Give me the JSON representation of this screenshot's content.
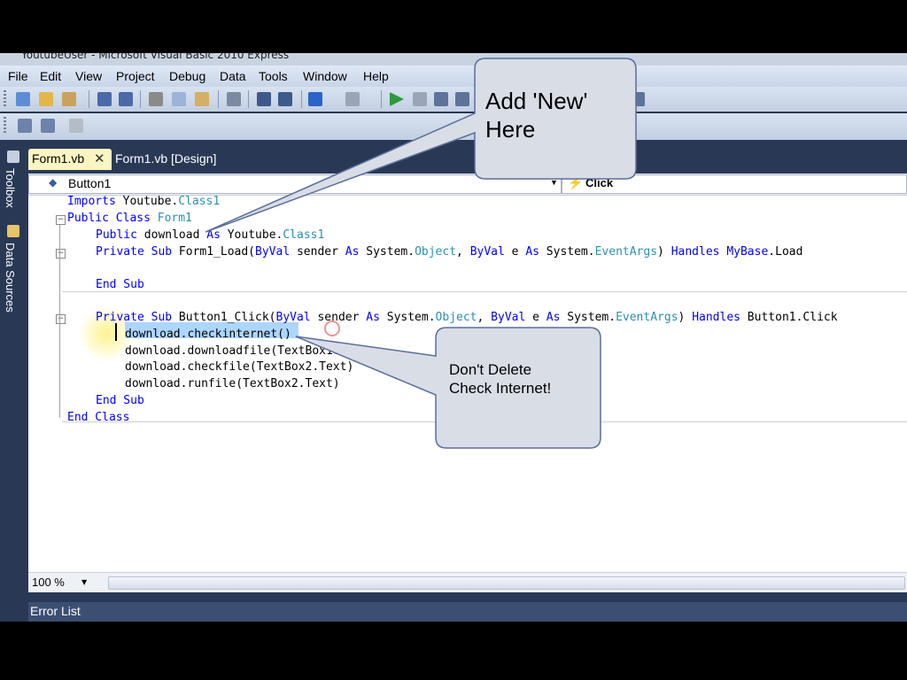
{
  "window": {
    "title": "YoutubeUser - Microsoft Visual Basic 2010 Express"
  },
  "menu": [
    "File",
    "Edit",
    "View",
    "Project",
    "Debug",
    "Data",
    "Tools",
    "Window",
    "Help"
  ],
  "side_tabs": [
    "Toolbox",
    "Data Sources"
  ],
  "tabs": [
    {
      "label": "Form1.vb",
      "active": true
    },
    {
      "label": "Form1.vb [Design]",
      "active": false
    }
  ],
  "nav": {
    "object": "Button1",
    "event": "Click"
  },
  "code": {
    "line1": {
      "kw": "Imports",
      "rest": " Youtube.",
      "type": "Class1"
    },
    "line2": {
      "kw": "Public Class",
      "name": " Form1"
    },
    "line3": {
      "kw1": "Public",
      "mid": " download ",
      "kw2": "As",
      "ns": " Youtube.",
      "type": "Class1"
    },
    "line4": {
      "kw1": "Private Sub",
      "name": " Form1_Load(",
      "kw2": "ByVal",
      "p1": " sender ",
      "kw3": "As",
      "ns1": " System.",
      "ty1": "Object",
      "comma": ", ",
      "kw4": "ByVal",
      "p2": " e ",
      "kw5": "As",
      "ns2": " System.",
      "ty2": "EventArgs",
      "close": ") ",
      "kw6": "Handles",
      "kw7": " MyBase",
      "tail": ".Load"
    },
    "line5": {
      "kw": "End Sub"
    },
    "line6": {
      "kw1": "Private Sub",
      "name": " Button1_Click(",
      "kw2": "ByVal",
      "p1": " sender ",
      "kw3": "As",
      "ns1": " System.",
      "ty1": "Object",
      "comma": ", ",
      "kw4": "ByVal",
      "p2": " e ",
      "kw5": "As",
      "ns2": " System.",
      "ty2": "EventArgs",
      "close": ") ",
      "kw6": "Handles",
      "tail": " Button1.Click"
    },
    "line7": "download.checkinternet()",
    "line8": "download.downloadfile(TextBox1.Te",
    "line9": "download.checkfile(TextBox2.Text)",
    "line10": "download.runfile(TextBox2.Text)",
    "line11": {
      "kw": "End Sub"
    },
    "line12": {
      "kw": "End Class"
    }
  },
  "zoom": "100 %",
  "error_list": "Error List",
  "callouts": {
    "add_new": {
      "line1": "Add 'New'",
      "line2": "Here"
    },
    "dont_delete": {
      "line1": "Don't Delete",
      "line2": "Check Internet!"
    }
  },
  "colors": {
    "keyword": "#0000ff",
    "type": "#2b91af",
    "ide_background": "#293955",
    "active_tab": "#fcf4c2",
    "selection": "#add6ff",
    "callout_fill": "#d9dde6"
  }
}
